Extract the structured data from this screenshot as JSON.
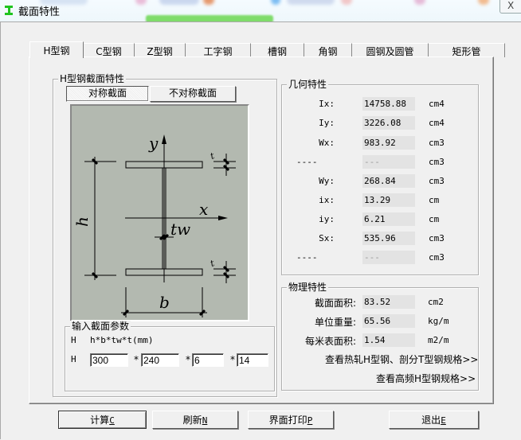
{
  "window": {
    "title": "截面特性",
    "close_label": "X"
  },
  "tabs": [
    {
      "label": "H型钢",
      "active": true
    },
    {
      "label": "C型钢",
      "active": false
    },
    {
      "label": "Z型钢",
      "active": false
    },
    {
      "label": "工字钢",
      "active": false
    },
    {
      "label": "槽钢",
      "active": false
    },
    {
      "label": "角钢",
      "active": false
    },
    {
      "label": "圆钢及圆管",
      "active": false
    },
    {
      "label": "矩形管",
      "active": false
    }
  ],
  "section": {
    "group_label": "H型钢截面特性",
    "symmetric_label": "对称截面",
    "asymmetric_label": "不对称截面",
    "diagram": {
      "y_axis": "y",
      "x_axis": "x",
      "h": "h",
      "b": "b",
      "tw": "tw",
      "t": "t"
    }
  },
  "input": {
    "group_label": "输入截面参数",
    "type_label": "H",
    "formula": "h*b*tw*t(mm)",
    "row_label": "H",
    "separator": "*",
    "h": "300",
    "b": "240",
    "tw": "6",
    "t": "14"
  },
  "geometry": {
    "group_label": "几何特性",
    "rows": [
      {
        "label": "Ix:",
        "value": "14758.88",
        "unit": "cm4",
        "dim": false
      },
      {
        "label": "Iy:",
        "value": "3226.08",
        "unit": "cm4",
        "dim": false
      },
      {
        "label": "Wx:",
        "value": "983.92",
        "unit": "cm3",
        "dim": false
      },
      {
        "label": "----",
        "value": "---",
        "unit": "cm3",
        "dim": true
      },
      {
        "label": "Wy:",
        "value": "268.84",
        "unit": "cm3",
        "dim": false
      },
      {
        "label": "ix:",
        "value": "13.29",
        "unit": "cm",
        "dim": false
      },
      {
        "label": "iy:",
        "value": "6.21",
        "unit": "cm",
        "dim": false
      },
      {
        "label": "Sx:",
        "value": "535.96",
        "unit": "cm3",
        "dim": false
      },
      {
        "label": "----",
        "value": "---",
        "unit": "cm3",
        "dim": true
      }
    ]
  },
  "physical": {
    "group_label": "物理特性",
    "rows": [
      {
        "label": "截面面积:",
        "value": "83.52",
        "unit": "cm2"
      },
      {
        "label": "单位重量:",
        "value": "65.56",
        "unit": "kg/m"
      },
      {
        "label": "每米表面积:",
        "value": "1.54",
        "unit": "m2/m"
      }
    ],
    "link_hot_rolled": "查看热轧H型钢、剖分T型钢规格>>",
    "link_high_freq": "查看高频H型钢规格>>"
  },
  "buttons": {
    "calc": {
      "label": "计算",
      "hotkey": "C"
    },
    "refresh": {
      "label": "刷新",
      "hotkey": "N"
    },
    "print": {
      "label": "界面打印",
      "hotkey": "P"
    },
    "exit": {
      "label": "退出",
      "hotkey": "E"
    }
  }
}
